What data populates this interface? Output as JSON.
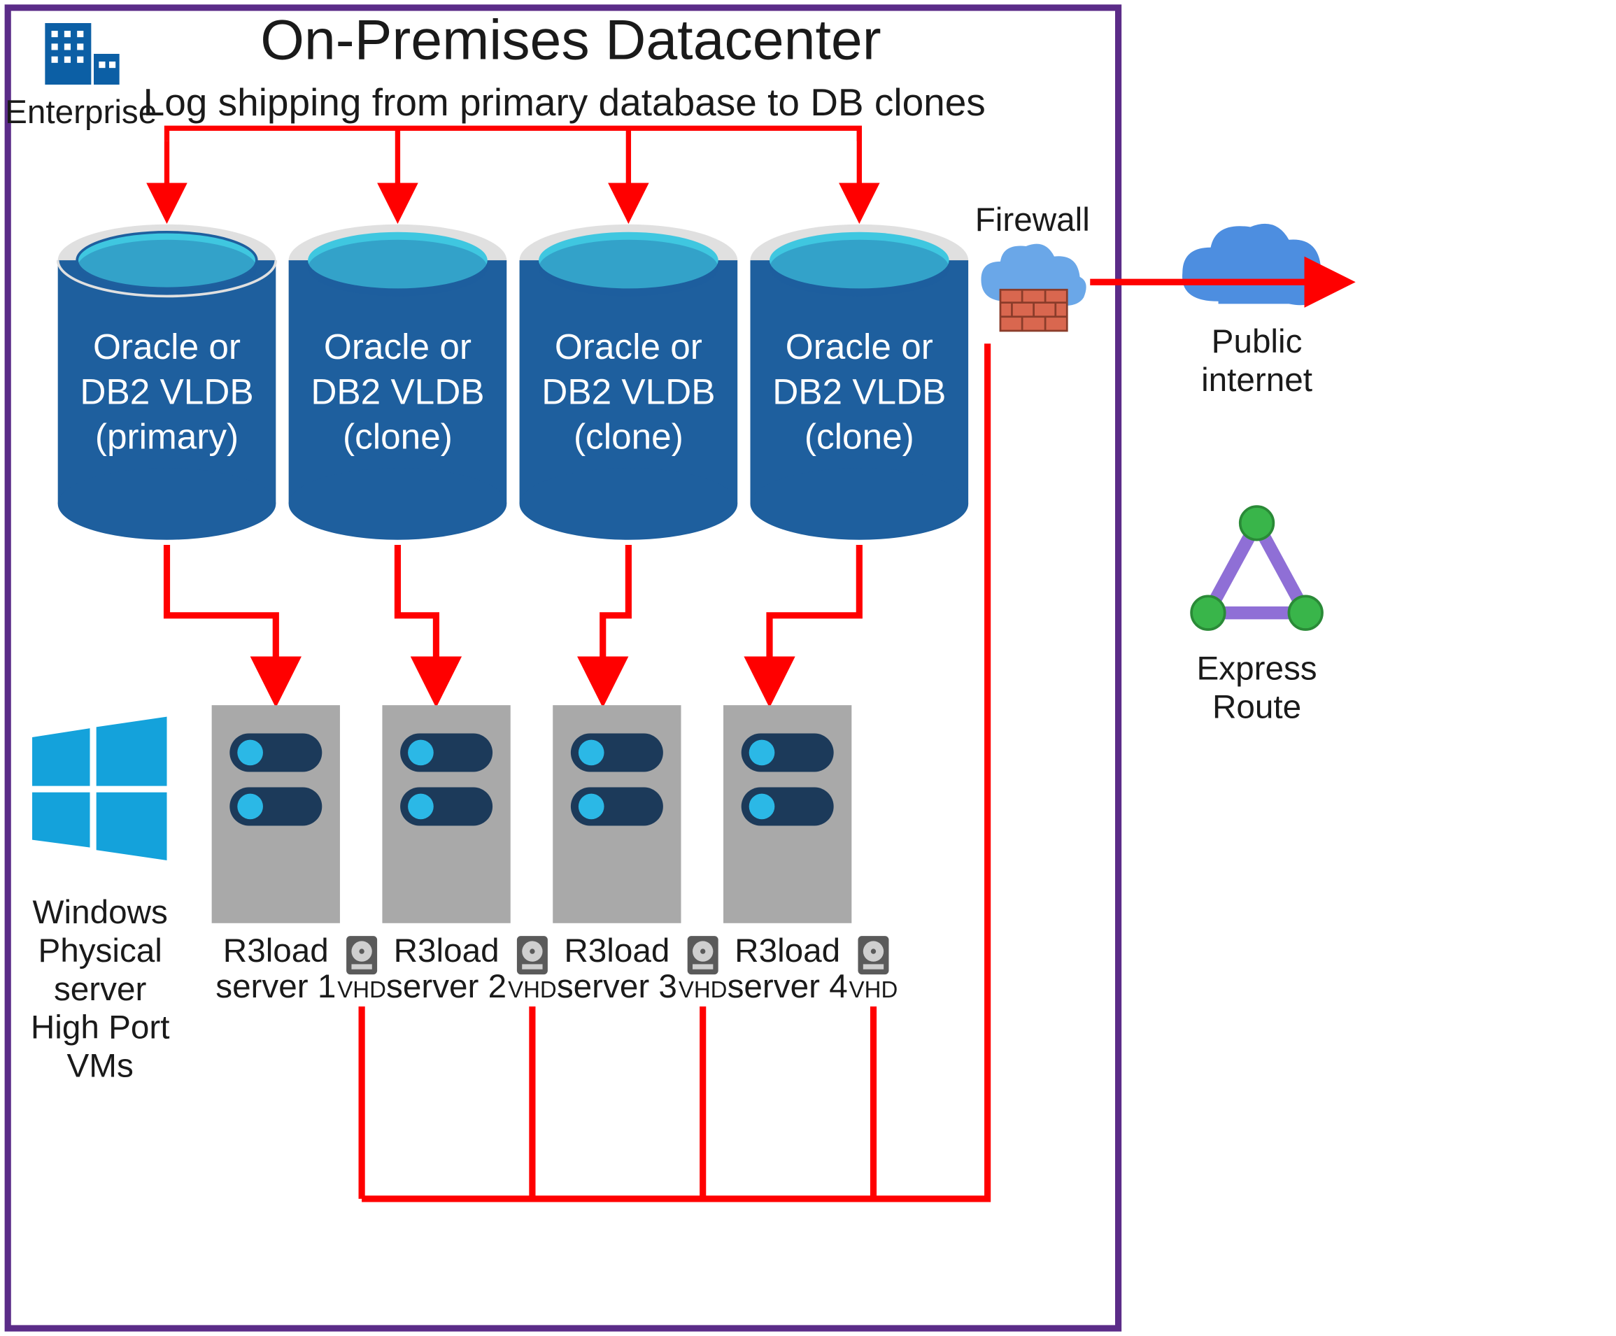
{
  "title": "On-Premises Datacenter",
  "subtitle": "Log shipping from primary database to DB clones",
  "enterprise_label": "Enterprise",
  "firewall_label": "Firewall",
  "public_internet_label1": "Public",
  "public_internet_label2": "internet",
  "express_route_label1": "Express",
  "express_route_label2": "Route",
  "windows_label1": "Windows",
  "windows_label2": "Physical",
  "windows_label3": "server",
  "windows_label4": "High Port",
  "windows_label5": "VMs",
  "db": [
    {
      "l1": "Oracle or",
      "l2": "DB2 VLDB",
      "l3": "(primary)"
    },
    {
      "l1": "Oracle or",
      "l2": "DB2 VLDB",
      "l3": "(clone)"
    },
    {
      "l1": "Oracle or",
      "l2": "DB2 VLDB",
      "l3": "(clone)"
    },
    {
      "l1": "Oracle or",
      "l2": "DB2 VLDB",
      "l3": "(clone)"
    }
  ],
  "servers": [
    {
      "l1": "R3load",
      "l2": "server 1",
      "vhd": "VHD"
    },
    {
      "l1": "R3load",
      "l2": "server 2",
      "vhd": "VHD"
    },
    {
      "l1": "R3load",
      "l2": "server 3",
      "vhd": "VHD"
    },
    {
      "l1": "R3load",
      "l2": "server 4",
      "vhd": "VHD"
    }
  ],
  "colors": {
    "border": "#5b2c88",
    "arrow": "#ff0000",
    "dbTop": "#3fc7e0",
    "dbRim": "#e0e0e0",
    "dbBody": "#1e5f9e",
    "server": "#a9a9a9",
    "slotDark": "#1c3a5a",
    "slotLight": "#2bb8e6",
    "cloud": "#4d8ee0",
    "firewallCloud": "#6aa7e8",
    "brick": "#d9674f",
    "brickLine": "#8a3c2a",
    "windows": "#14a2db",
    "enterprise": "#0c5fa5",
    "erLine": "#8f6fd6",
    "erNode": "#39b54a"
  }
}
